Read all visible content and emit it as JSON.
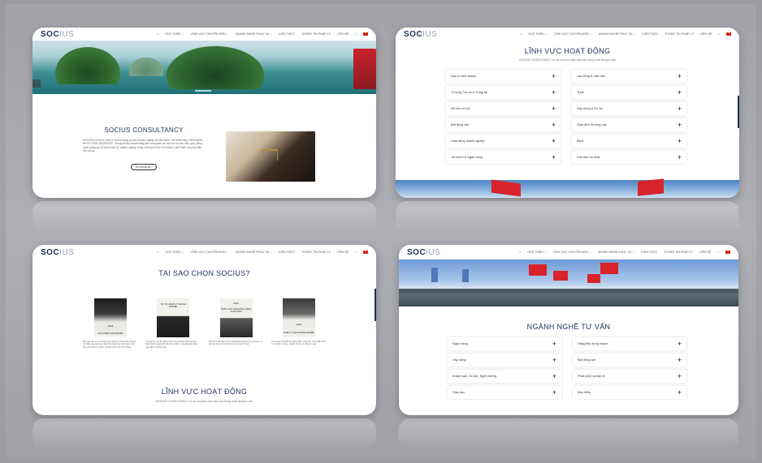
{
  "nav": {
    "logo_main": "SOC",
    "logo_accent": "IUS",
    "items": [
      "GIỚI THIỆU ⌄",
      "LĨNH VỰC CHUYÊN MÔN ⌄",
      "NGÀNH NGHỀ PHỤC VỤ ⌄",
      "KIẾN THỨC",
      "THÔNG TIN PHÁP LÝ",
      "LIÊN HỆ"
    ]
  },
  "panel1": {
    "title": "SOCIUS CONSULTANCY",
    "paragraph": "SOCIUS CONSULTANCY là một công ty luật chuyên nghiệp tại Việt Nam. Với khẩu hiệu \"GROWING WITH YOUR BUSINESS\", chúng tôi lấy khách hàng làm trung tâm và cam kết tư vấn hiệu quả, đồng hành cùng các tổ chức kinh tế, doanh nghiệp trong suốt quá trình hình thành, vận hành và phát triển bền vững.",
    "button": "Về chúng tôi ⟩"
  },
  "panel2": {
    "title": "LĨNH VỰC HOẠT ĐỘNG",
    "subtitle": "SOCIUS CONSULTANCY có sự chuyên môn hóa cao trong hoạt động tư vấn",
    "items": [
      "Đầu tư kinh doanh",
      "Lao động & Việc làm",
      "Tố tụng Tòa án & Trọng tài",
      "Thuế",
      "Sở hữu trí tuệ",
      "Xây dựng & Dự án",
      "Bất động sản",
      "Giao dịch thương mại",
      "Hoạt động doanh nghiệp",
      "M&A",
      "Tài chính & Ngân hàng",
      "Các dịch vụ khác"
    ]
  },
  "panel3": {
    "title": "TẠI SAO CHỌN SOCIUS?",
    "cards": [
      {
        "badge": "2022",
        "caption": "LUẬT PHÁP KHỞI NGHIỆP",
        "text": "Đội ngũ luật sư và chuyên gia pháp lý nhiều kinh nghiệm, am hiểu sâu sắc thực tiễn kinh doanh tại Việt Nam, luôn sẵn sàng hỗ trợ doanh nghiệp trong mọi tình huống."
      },
      {
        "badge": "",
        "caption": "SỔ TAY PHÁP LÝ DOANH NGHIỆP",
        "text": "Chúng tôi cam kết đồng hành cùng khách hàng từ giai đoạn khởi nghiệp đến khi phát triển, cung cấp giải pháp toàn diện và hiệu quả."
      },
      {
        "badge": "2022",
        "caption": "PHÁP LUẬT LIÊN ĐỒNG HÀNH CÙNG BẠN",
        "text": "SOCIUS luôn lấy lợi ích của khách hàng làm trọng tâm, tư vấn tận tâm với chi phí hợp lý và minh bạch."
      },
      {
        "badge": "2022",
        "caption": "PHÁP LÝ CHO DOANH NGHIỆP",
        "text": "Với mạng lưới đối tác rộng khắp, chúng tôi mang đến dịch vụ chuyên nghiệp, nhanh chóng và đáng tin cậy."
      }
    ],
    "title2": "LĨNH VỰC HOẠT ĐỘNG",
    "subtitle2": "SOCIUS CONSULTANCY có sự chuyên môn hóa cao trong hoạt động tư vấn"
  },
  "panel4": {
    "title": "NGÀNH NGHỀ TƯ VẤN",
    "items": [
      "Ngân hàng",
      "Hàng tiêu dùng nhanh",
      "Xây dựng",
      "Bất động sản",
      "Khách sạn, Du lịch, Nghỉ dưỡng",
      "Phân phối và bán lẻ",
      "Giáo dục",
      "Bảo hiểm"
    ]
  },
  "colors": {
    "brand": "#1f2d5a",
    "accent": "#d8232a"
  },
  "icons": [
    "home-icon",
    "search-icon",
    "flag-icon",
    "plus-icon"
  ]
}
